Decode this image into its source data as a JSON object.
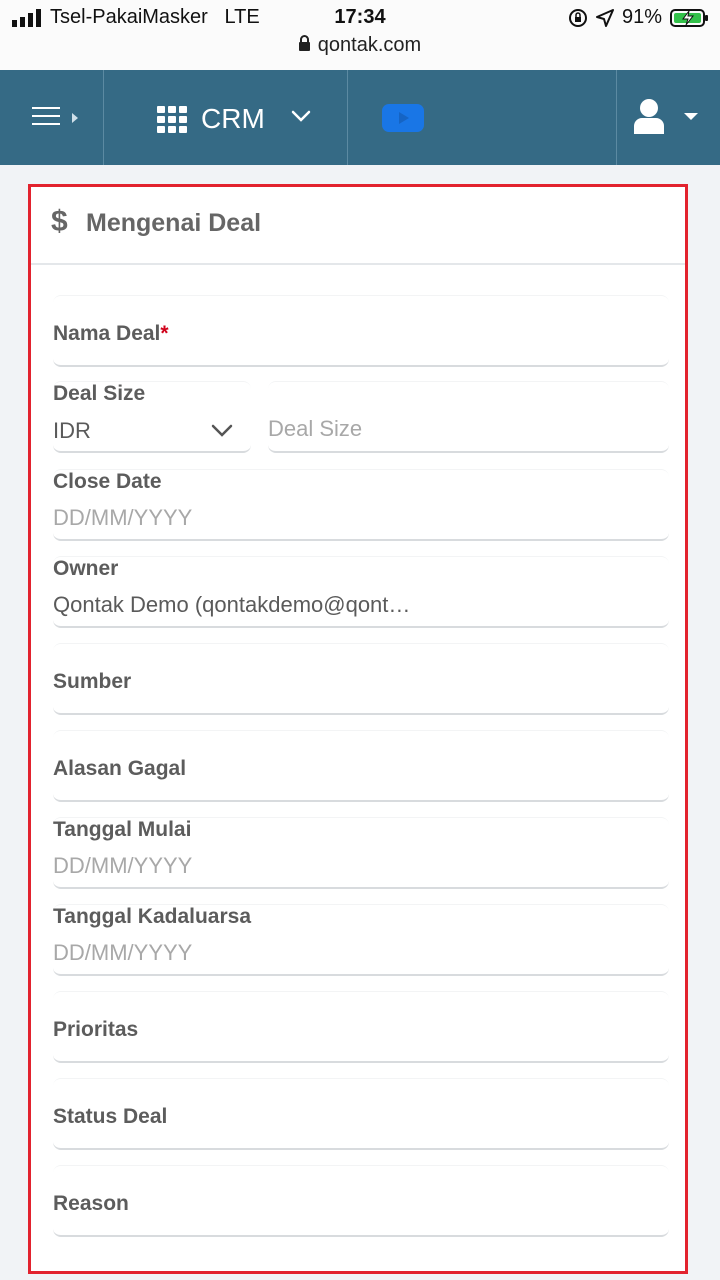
{
  "status_bar": {
    "carrier": "Tsel-PakaiMasker",
    "network": "LTE",
    "time": "17:34",
    "battery": "91%",
    "url": "qontak.com"
  },
  "navbar": {
    "app_label": "CRM",
    "icons": [
      "menu-icon",
      "apps-grid-icon",
      "chevron-down-icon",
      "youtube-icon",
      "user-icon",
      "caret-down-icon"
    ],
    "colors": {
      "background": "#356a85",
      "video_button": "#1976e6"
    }
  },
  "section": {
    "icon": "dollar-icon",
    "title": "Mengenai Deal",
    "border_color": "#e2222e"
  },
  "form": {
    "nama_deal": {
      "label": "Nama Deal",
      "required_mark": "*"
    },
    "deal_size": {
      "label": "Deal Size",
      "currency": "IDR",
      "placeholder": "Deal Size"
    },
    "close_date": {
      "label": "Close Date",
      "placeholder": "DD/MM/YYYY"
    },
    "owner": {
      "label": "Owner",
      "value": "Qontak Demo (qontakdemo@qont…"
    },
    "sumber": {
      "label": "Sumber"
    },
    "alasan_gagal": {
      "label": "Alasan Gagal"
    },
    "tanggal_mulai": {
      "label": "Tanggal Mulai",
      "placeholder": "DD/MM/YYYY"
    },
    "tanggal_kadaluarsa": {
      "label": "Tanggal Kadaluarsa",
      "placeholder": "DD/MM/YYYY"
    },
    "prioritas": {
      "label": "Prioritas"
    },
    "status_deal": {
      "label": "Status Deal"
    },
    "reason": {
      "label": "Reason"
    }
  }
}
